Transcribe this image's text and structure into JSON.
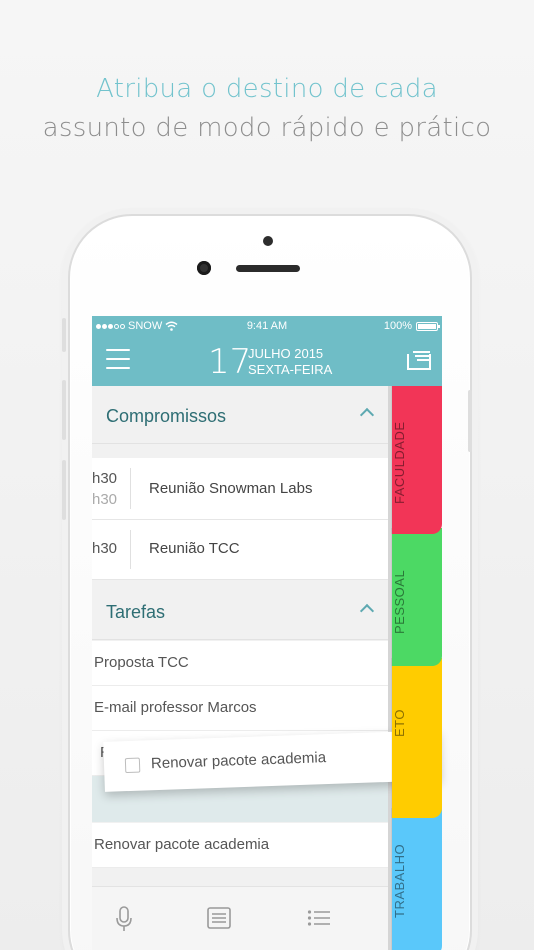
{
  "headline": {
    "line1": "Atribua o destino de cada",
    "line2": "assunto de modo rápido e prático"
  },
  "status_bar": {
    "carrier": "SNOW",
    "time": "9:41 AM",
    "battery": "100%"
  },
  "header": {
    "day": "17",
    "month_year": "JULHO 2015",
    "weekday": "SEXTA-FEIRA"
  },
  "sections": {
    "appointments_title": "Compromissos",
    "tasks_title": "Tarefas"
  },
  "appointments": [
    {
      "time": "h30",
      "time_end": "h30",
      "title": "Reunião Snowman Labs"
    },
    {
      "time": "h30",
      "title": "Reunião TCC"
    }
  ],
  "tasks": [
    {
      "title": "Proposta TCC"
    },
    {
      "title": "E-mail professor Marcos"
    },
    {
      "title": "R"
    },
    {
      "title": "Renovar pacote academia"
    }
  ],
  "dragged_card": {
    "title": "Renovar pacote academia",
    "checked": false
  },
  "tabs": [
    {
      "label": "FACULDADE",
      "color": "#f23557"
    },
    {
      "label": "PESSOAL",
      "color": "#4cd964"
    },
    {
      "label": "ETO",
      "color": "#ffcc00"
    },
    {
      "label": "TRABALHO",
      "color": "#5ac8fa"
    }
  ],
  "bottom_bar": [
    "microphone-icon",
    "note-icon",
    "list-icon"
  ],
  "colors": {
    "accent": "#6fbdc6",
    "section_title": "#2e6e74"
  }
}
